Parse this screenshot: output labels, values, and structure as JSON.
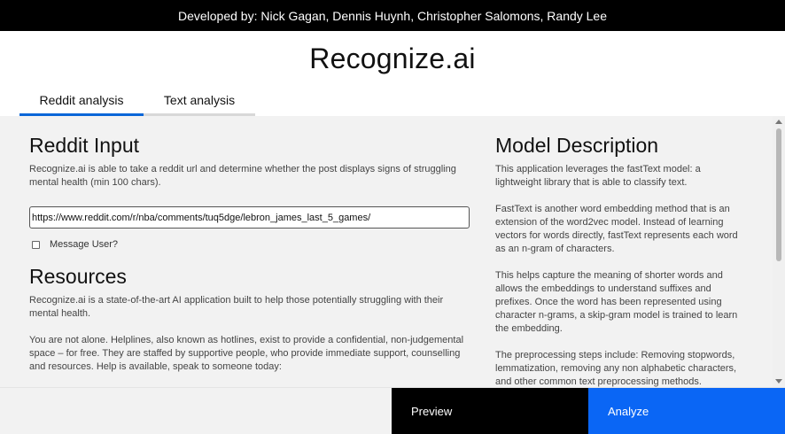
{
  "header": {
    "developers": "Developed by: Nick Gagan, Dennis Huynh, Christopher Salomons, Randy Lee",
    "app_title": "Recognize.ai"
  },
  "tabs": [
    {
      "label": "Reddit analysis",
      "active": true
    },
    {
      "label": "Text analysis",
      "active": false
    }
  ],
  "reddit_input": {
    "heading": "Reddit Input",
    "description": "Recognize.ai is able to take a reddit url and determine whether the post displays signs of struggling mental health (min 100 chars).",
    "url_value": "https://www.reddit.com/r/nba/comments/tuq5dge/lebron_james_last_5_games/",
    "message_user_label": "Message User?",
    "message_user_checked": false
  },
  "resources": {
    "heading": "Resources",
    "paragraphs": [
      "Recognize.ai is a state-of-the-art AI application built to help those potentially struggling with their mental health.",
      "You are not alone. Helplines, also known as hotlines, exist to provide a confidential, non-judgemental space – for free. They are staffed by supportive people, who provide immediate support, counselling and resources. Help is available, speak to someone today:"
    ]
  },
  "model_description": {
    "heading": "Model Description",
    "paragraphs": [
      "This application leverages the fastText model: a lightweight library that is able to classify text.",
      "FastText is another word embedding method that is an extension of the word2vec model. Instead of learning vectors for words directly, fastText represents each word as an n-gram of characters.",
      "This helps capture the meaning of shorter words and allows the embeddings to understand suffixes and prefixes. Once the word has been represented using character n-grams, a skip-gram model is trained to learn the embedding.",
      "The preprocessing steps include: Removing stopwords, lemmatization, removing any non alphabetic characters, and other common text preprocessing methods."
    ]
  },
  "actions": {
    "preview_label": "Preview",
    "analyze_label": "Analyze"
  },
  "colors": {
    "accent": "#0a66f5",
    "topbar": "#000000",
    "content_bg": "#f2f2f2"
  }
}
